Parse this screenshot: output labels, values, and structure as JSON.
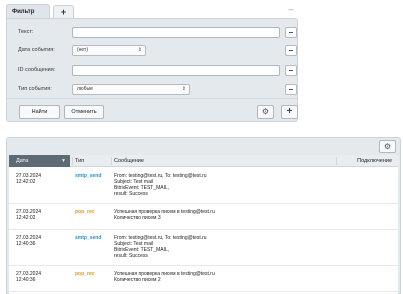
{
  "filter": {
    "tab_active": "Фильтр",
    "tab_add": "+",
    "collapse": "–",
    "fields": [
      {
        "label": "Текст:",
        "kind": "text",
        "value": ""
      },
      {
        "label": "Дата события:",
        "kind": "select",
        "value": "(нет)"
      },
      {
        "label": "ID сообщения:",
        "kind": "text",
        "value": ""
      },
      {
        "label": "Тип события:",
        "kind": "select",
        "value": "любые"
      }
    ],
    "remove_label": "–",
    "find_label": "Найти",
    "cancel_label": "Отменить",
    "gear_glyph": "⚙",
    "plus_label": "+"
  },
  "grid": {
    "gear_glyph": "⚙",
    "headers": {
      "date": "Дата",
      "sort_glyph": "▼",
      "type": "Тип",
      "message": "Сообщение",
      "confirm": "Подключение"
    },
    "rows": [
      {
        "date": [
          "27.03.2024",
          "12:42:02"
        ],
        "type": "smtp_send",
        "message": [
          "From: testing@test.ru, To: testing@test.ru",
          "Subject: Test mail",
          "BitrixEvent: TEST_MAIL,",
          "result: Success"
        ]
      },
      {
        "date": [
          "27.03.2024",
          "12:42:02"
        ],
        "type": "pop_rec",
        "message": [
          "Успешная проверка писем в testing@test.ru",
          "Количество писем 3"
        ]
      },
      {
        "date": [
          "27.03.2024",
          "12:40:36"
        ],
        "type": "smtp_send",
        "message": [
          "From: testing@test.ru, To: testing@test.ru",
          "Subject: Test mail",
          "BitrixEvent: TEST_MAIL,",
          "result: Success"
        ]
      },
      {
        "date": [
          "27.03.2024",
          "12:40:36"
        ],
        "type": "pop_rec",
        "message": [
          "Успешная проверка писем в testing@test.ru",
          "Количество писем 2"
        ]
      }
    ]
  },
  "colors": {
    "smtp_send": "#2e8fd0",
    "pop_rec": "#e69a1a"
  }
}
